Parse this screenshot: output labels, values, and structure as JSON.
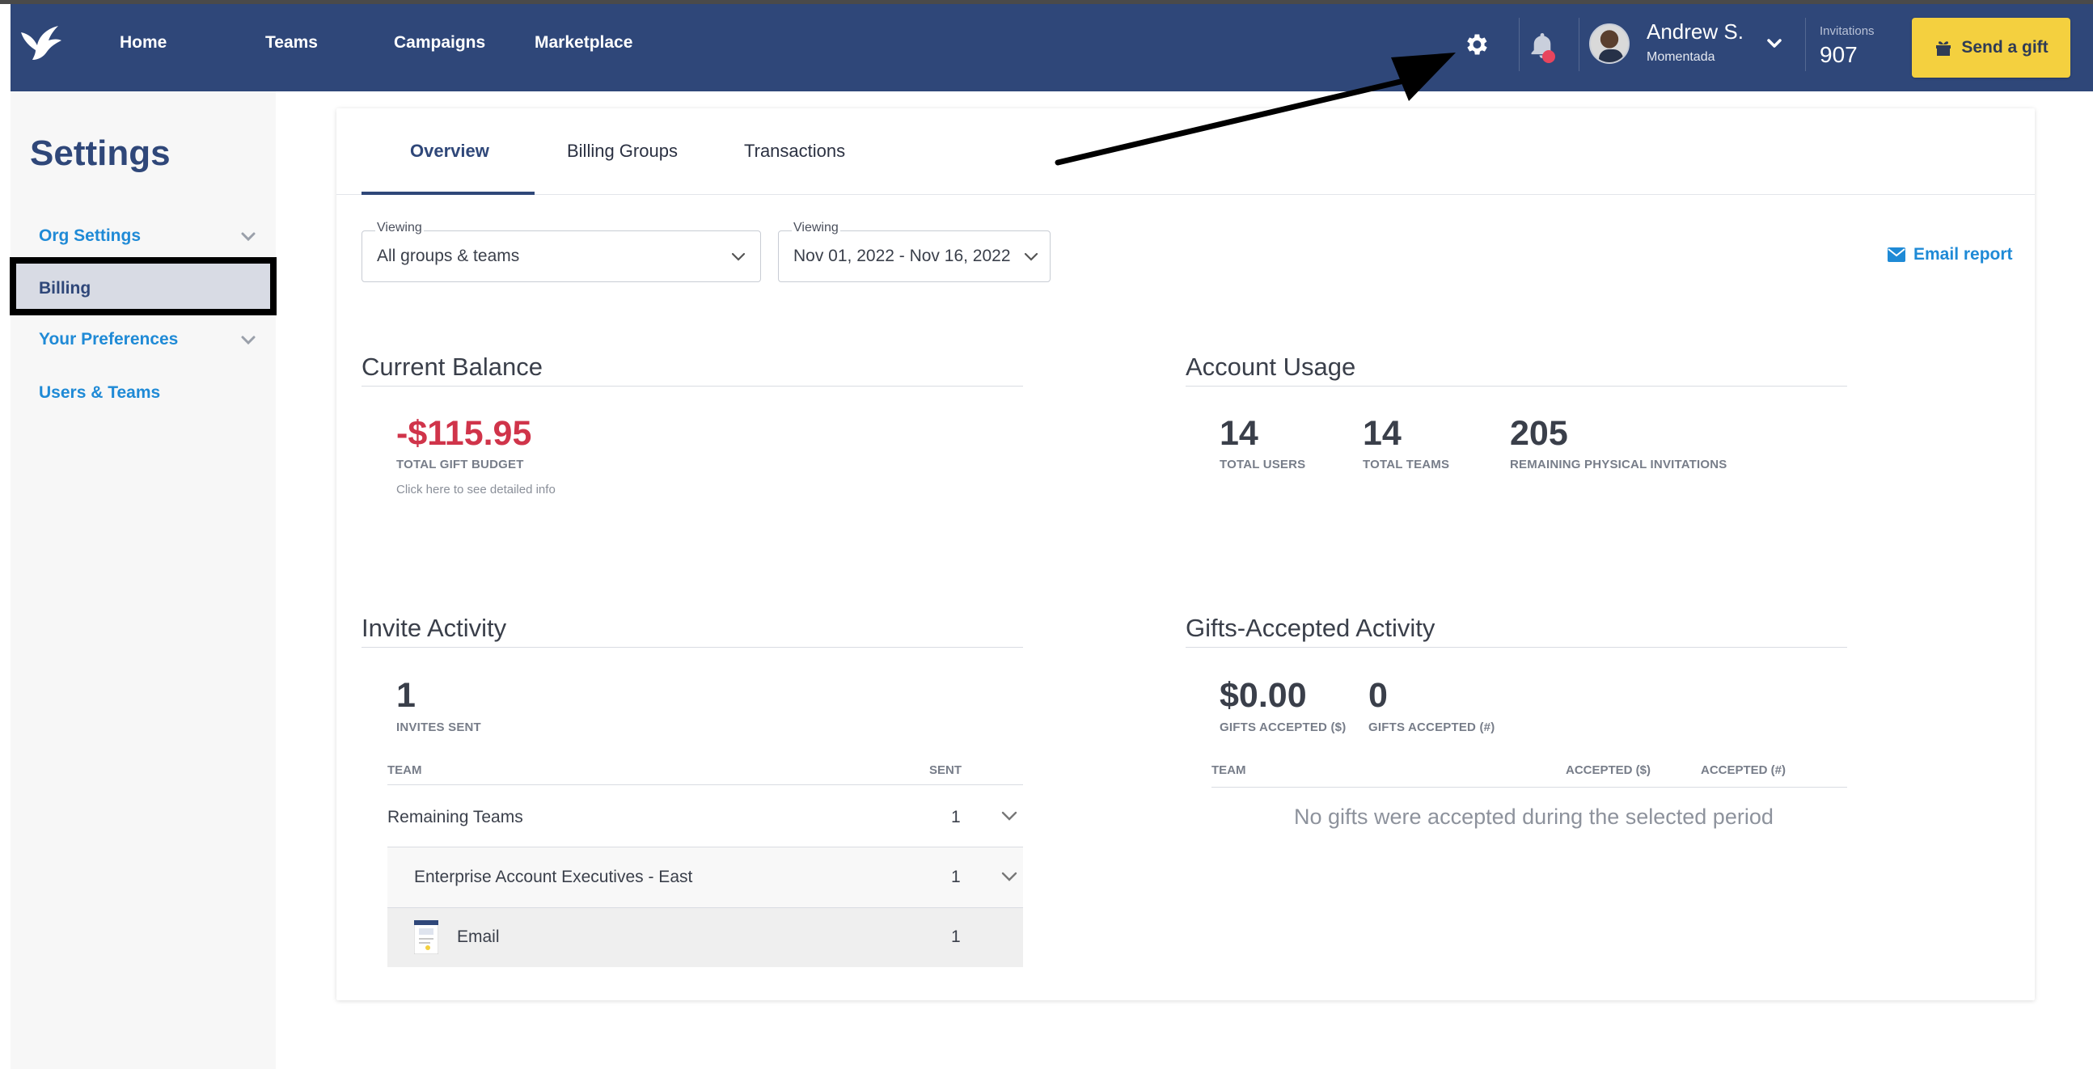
{
  "nav": {
    "links": [
      "Home",
      "Teams",
      "Campaigns",
      "Marketplace"
    ],
    "user_name": "Andrew S.",
    "user_org": "Momentada",
    "invitations_label": "Invitations",
    "invitations_count": "907",
    "send_gift_label": "Send a gift",
    "brand_color": "#2f4779",
    "accent_color": "#f4d03f",
    "icons": [
      "bird-logo-icon",
      "gear-icon",
      "bell-icon",
      "chevron-down-icon",
      "gift-icon"
    ]
  },
  "sidebar": {
    "title": "Settings",
    "items": [
      {
        "label": "Org Settings",
        "expandable": true
      },
      {
        "label": "Billing",
        "active": true
      },
      {
        "label": "Your Preferences",
        "expandable": true
      },
      {
        "label": "Users & Teams"
      }
    ]
  },
  "tabs": [
    "Overview",
    "Billing Groups",
    "Transactions"
  ],
  "filters": {
    "viewing_label": "Viewing",
    "group_value": "All groups & teams",
    "date_label": "Viewing",
    "date_value": "Nov 01, 2022 - Nov 16, 2022",
    "email_report": "Email report"
  },
  "current_balance": {
    "title": "Current Balance",
    "value": "-$115.95",
    "label": "TOTAL GIFT BUDGET",
    "detail": "Click here to see detailed info",
    "value_color": "#d0344a"
  },
  "account_usage": {
    "title": "Account Usage",
    "stats": [
      {
        "value": "14",
        "label": "TOTAL USERS"
      },
      {
        "value": "14",
        "label": "TOTAL TEAMS"
      },
      {
        "value": "205",
        "label": "REMAINING PHYSICAL INVITATIONS"
      }
    ]
  },
  "invite_activity": {
    "title": "Invite Activity",
    "value": "1",
    "label": "INVITES SENT",
    "columns": [
      "TEAM",
      "SENT"
    ],
    "rows": [
      {
        "team": "Remaining Teams",
        "sent": "1"
      },
      {
        "team": "Enterprise Account Executives - East",
        "sent": "1"
      },
      {
        "team": "Email",
        "sent": "1"
      }
    ]
  },
  "gifts_accepted": {
    "title": "Gifts-Accepted Activity",
    "stats": [
      {
        "value": "$0.00",
        "label": "GIFTS ACCEPTED ($)"
      },
      {
        "value": "0",
        "label": "GIFTS ACCEPTED (#)"
      }
    ],
    "columns": [
      "TEAM",
      "ACCEPTED ($)",
      "ACCEPTED (#)"
    ],
    "empty_message": "No gifts were accepted during the selected period"
  }
}
